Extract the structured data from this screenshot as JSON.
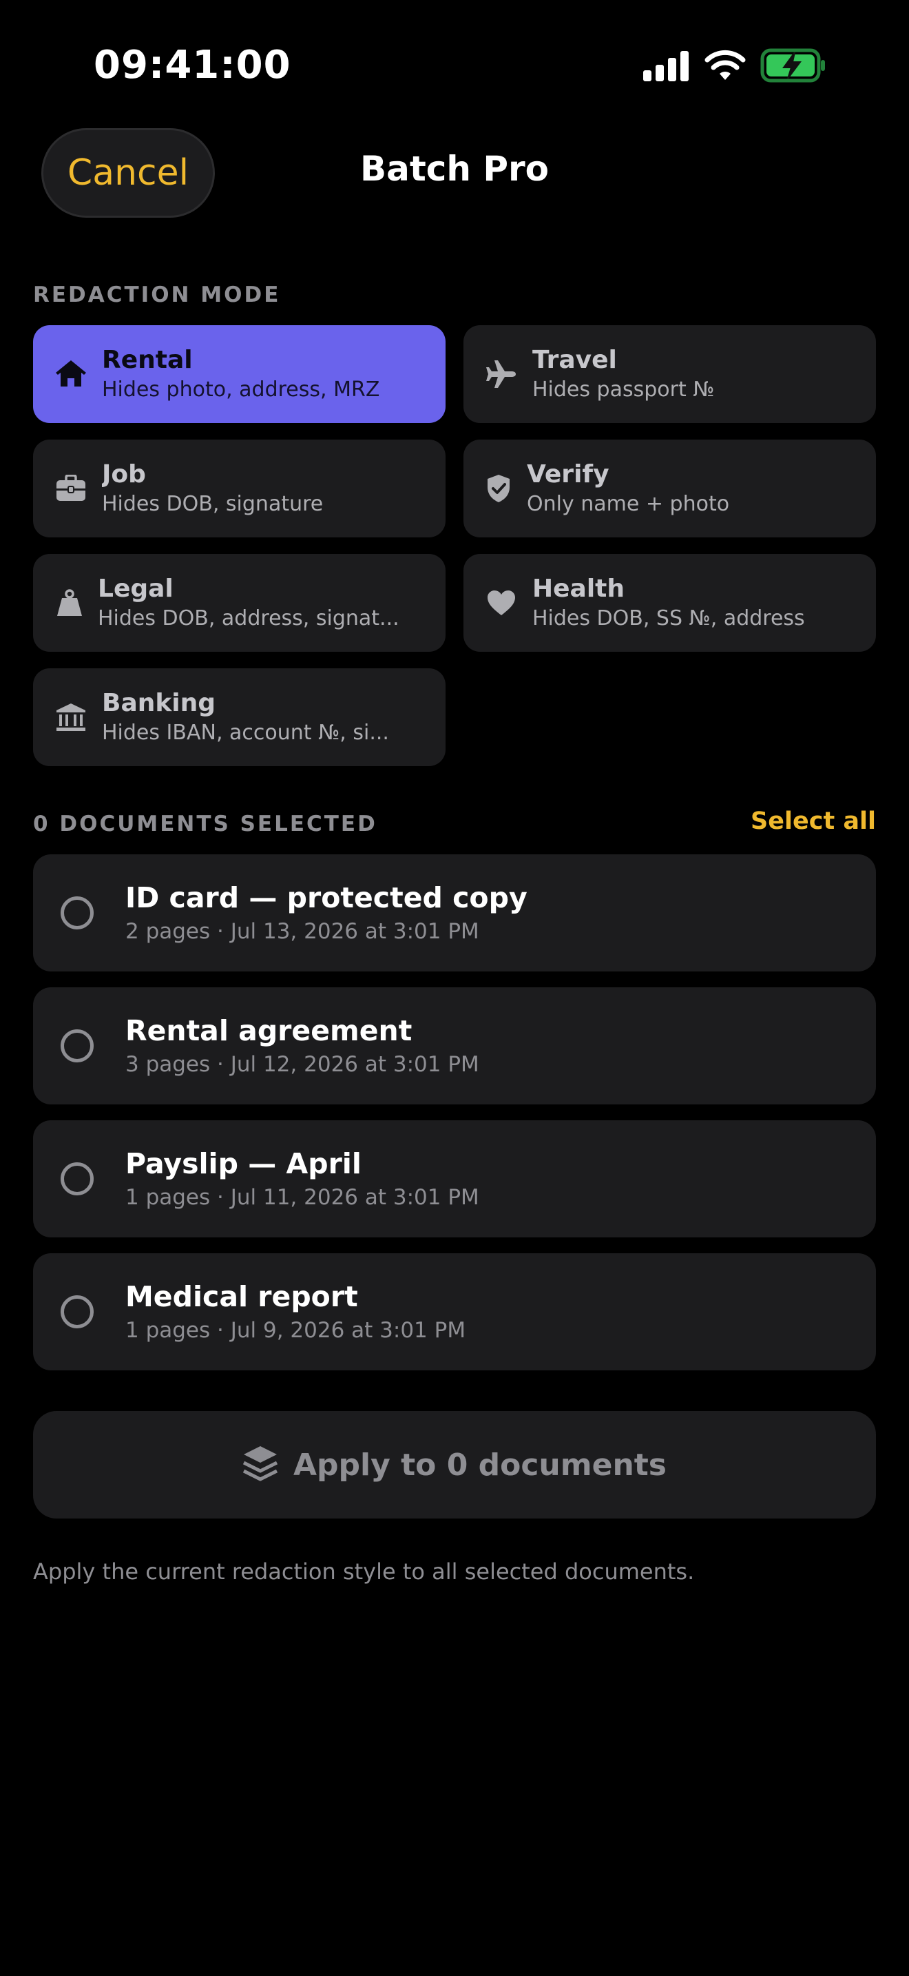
{
  "status_bar": {
    "time": "09:41:00"
  },
  "nav": {
    "cancel_label": "Cancel",
    "title": "Batch Pro"
  },
  "redaction_mode": {
    "section_label": "REDACTION MODE",
    "selected": "Rental",
    "modes": [
      {
        "name": "Rental",
        "description": "Hides photo, address, MRZ",
        "icon": "house-icon"
      },
      {
        "name": "Travel",
        "description": "Hides passport №",
        "icon": "airplane-icon"
      },
      {
        "name": "Job",
        "description": "Hides DOB, signature",
        "icon": "briefcase-icon"
      },
      {
        "name": "Verify",
        "description": "Only name + photo",
        "icon": "shield-check-icon"
      },
      {
        "name": "Legal",
        "description": "Hides DOB, address, signat...",
        "icon": "weight-icon"
      },
      {
        "name": "Health",
        "description": "Hides DOB, SS №, address",
        "icon": "heart-icon"
      },
      {
        "name": "Banking",
        "description": "Hides IBAN, account №, si...",
        "icon": "bank-icon"
      }
    ]
  },
  "documents": {
    "section_label": "0 DOCUMENTS SELECTED",
    "select_all_label": "Select all",
    "items": [
      {
        "title": "ID card — protected copy",
        "meta": "2 pages · Jul 13, 2026 at 3:01 PM",
        "selected": false
      },
      {
        "title": "Rental agreement",
        "meta": "3 pages · Jul 12, 2026 at 3:01 PM",
        "selected": false
      },
      {
        "title": "Payslip — April",
        "meta": "1 pages · Jul 11, 2026 at 3:01 PM",
        "selected": false
      },
      {
        "title": "Medical report",
        "meta": "1 pages · Jul 9, 2026 at 3:01 PM",
        "selected": false
      }
    ]
  },
  "apply": {
    "label": "Apply to 0 documents",
    "icon": "layers-icon",
    "footnote": "Apply the current redaction style to all selected documents."
  },
  "colors": {
    "background": "#000000",
    "card": "#1c1c1e",
    "accent": "#f0b92e",
    "selected_mode": "#6a63ec",
    "battery": "#34c759"
  }
}
